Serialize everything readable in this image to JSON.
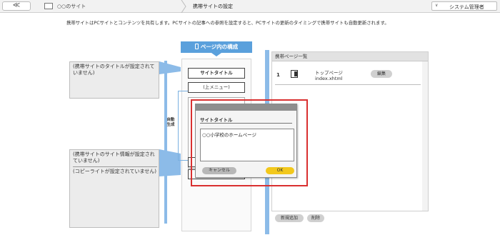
{
  "header": {
    "back_symbol": "≪",
    "site_name": "○○のサイト",
    "current_page": "携帯サイトの設定",
    "user_caret": "∨",
    "user_label": "システム管理者"
  },
  "description": "携帯サイトはPCサイトとコンテンツを共有します。PCサイトの記事への参照を設定すると、PCサイトの更新のタイミングで携帯サイトも自動更新されます。",
  "structure": {
    "header": "ページ内の構成",
    "site_title_slot": "サイトタイトル",
    "menu_slot": "(上メニュー)",
    "auto_generate": "自動\n生成"
  },
  "notes": {
    "title_note": "(携帯サイトのタイトルが設定されていません)",
    "info_note": "(携帯サイトのサイト情報が設定されていません)",
    "copyright_note": "(コピーライトが設定されていません)"
  },
  "mobile_pages": {
    "header": "携帯ページ一覧",
    "rows": [
      {
        "num": "1",
        "name": "トップページ",
        "file": "index.xhtml",
        "edit": "編集"
      }
    ],
    "add_button": "新規追加",
    "delete_button": "削除"
  },
  "dialog": {
    "title": "サイトタイトル",
    "input_value": "○○小学校のホームページ",
    "cancel": "キャンセル",
    "ok": "OK"
  },
  "colors": {
    "accent_blue": "#5aa0dc",
    "ok_yellow": "#f2c81c",
    "highlight_red": "#d93030"
  }
}
